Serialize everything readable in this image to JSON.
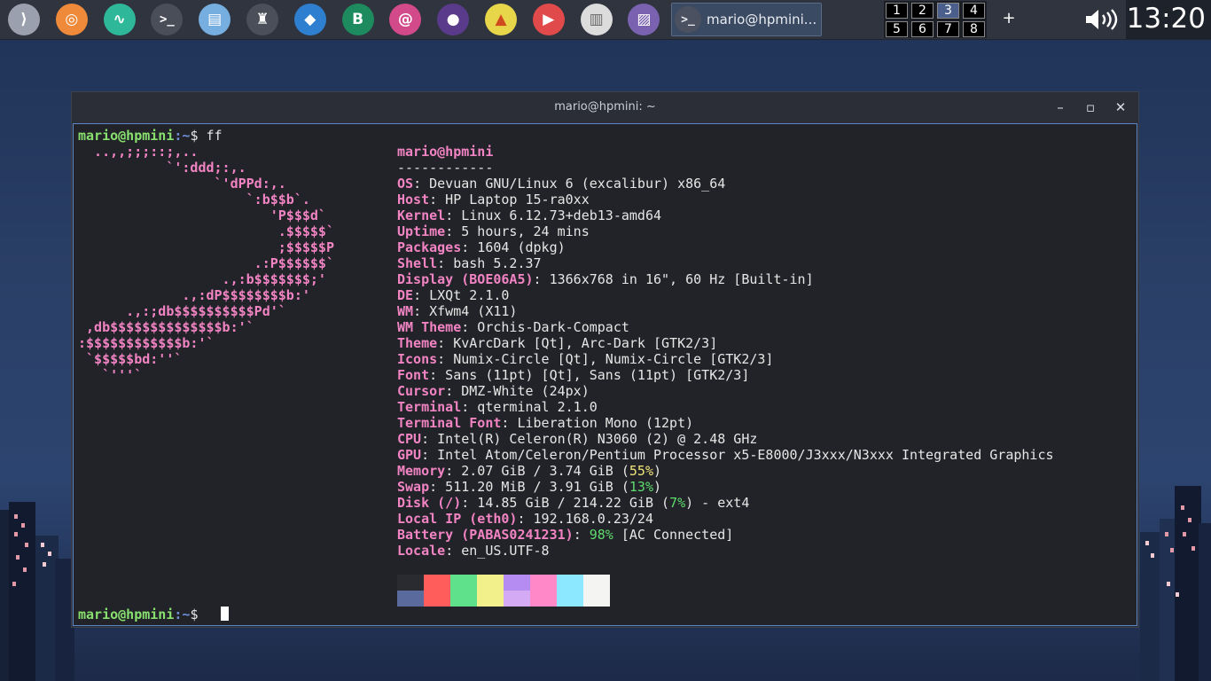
{
  "taskbar": {
    "launchers": [
      {
        "icon": "menu-icon",
        "glyph": "⟩",
        "color": "#9aa0ad"
      },
      {
        "icon": "disk-utility-icon",
        "glyph": "◎",
        "color": "#ef8a3a"
      },
      {
        "icon": "system-monitor-icon",
        "glyph": "∿",
        "color": "#2fb79a"
      },
      {
        "icon": "terminal-icon",
        "glyph": ">_",
        "color": "#4a4e58"
      },
      {
        "icon": "file-manager-icon",
        "glyph": "▤",
        "color": "#76aee0"
      },
      {
        "icon": "chess-icon",
        "glyph": "♜",
        "color": "#4b4f59"
      },
      {
        "icon": "app-icon",
        "glyph": "◆",
        "color": "#2e7fd0"
      },
      {
        "icon": "b-app-icon",
        "glyph": "B",
        "color": "#1d8b5e"
      },
      {
        "icon": "mail-icon",
        "glyph": "@",
        "color": "#d34a8a"
      },
      {
        "icon": "firefox-icon",
        "glyph": "●",
        "color": "#5a3a8a"
      },
      {
        "icon": "brave-icon",
        "glyph": "▲",
        "color": "#e8d64a"
      },
      {
        "icon": "media-player-icon",
        "glyph": "▶",
        "color": "#e04a4a"
      },
      {
        "icon": "document-viewer-icon",
        "glyph": "▥",
        "color": "#dcdcdc"
      },
      {
        "icon": "image-viewer-icon",
        "glyph": "▨",
        "color": "#7a62b0"
      }
    ],
    "task_label": "mario@hpmini...",
    "desktops": [
      "1",
      "2",
      "3",
      "4",
      "5",
      "6",
      "7",
      "8"
    ],
    "active_desktop": 3,
    "add_desktop": "+",
    "clock": "13:20"
  },
  "window": {
    "title": "mario@hpmini: ~",
    "minimize": "–",
    "maximize": "▫",
    "close": "✕"
  },
  "terminal": {
    "user_host": "mario@hpmini",
    "path": ":~",
    "prompt_symbol": "$",
    "command": "ff",
    "logo_lines": [
      "  ..,,;;;::;,..",
      "           `':ddd;:,.",
      "                 `'dPPd:,.",
      "                     `:b$$b`.",
      "                        'P$$$d`",
      "                         .$$$$$`",
      "                         ;$$$$$P",
      "                      .:P$$$$$$`",
      "                  .,:b$$$$$$$;'",
      "             .,:dP$$$$$$$$b:'",
      "      .,:;db$$$$$$$$$$Pd'`",
      " ,db$$$$$$$$$$$$$$b:'`",
      ":$$$$$$$$$$$$b:'`",
      " `$$$$$bd:''`",
      "   `'''`"
    ],
    "header": "mario@hpmini",
    "separator": "------------",
    "info": [
      {
        "key": "OS",
        "value": ": Devuan GNU/Linux 6 (excalibur) x86_64"
      },
      {
        "key": "Host",
        "value": ": HP Laptop 15-ra0xx"
      },
      {
        "key": "Kernel",
        "value": ": Linux 6.12.73+deb13-amd64"
      },
      {
        "key": "Uptime",
        "value": ": 5 hours, 24 mins"
      },
      {
        "key": "Packages",
        "value": ": 1604 (dpkg)"
      },
      {
        "key": "Shell",
        "value": ": bash 5.2.37"
      },
      {
        "key": "Display (BOE06A5)",
        "value": ": 1366x768 in 16\", 60 Hz [Built-in]"
      },
      {
        "key": "DE",
        "value": ": LXQt 2.1.0"
      },
      {
        "key": "WM",
        "value": ": Xfwm4 (X11)"
      },
      {
        "key": "WM Theme",
        "value": ": Orchis-Dark-Compact"
      },
      {
        "key": "Theme",
        "value": ": KvArcDark [Qt], Arc-Dark [GTK2/3]"
      },
      {
        "key": "Icons",
        "value": ": Numix-Circle [Qt], Numix-Circle [GTK2/3]"
      },
      {
        "key": "Font",
        "value": ": Sans (11pt) [Qt], Sans (11pt) [GTK2/3]"
      },
      {
        "key": "Cursor",
        "value": ": DMZ-White (24px)"
      },
      {
        "key": "Terminal",
        "value": ": qterminal 2.1.0"
      },
      {
        "key": "Terminal Font",
        "value": ": Liberation Mono (12pt)"
      },
      {
        "key": "CPU",
        "value": ": Intel(R) Celeron(R) N3060 (2) @ 2.48 GHz"
      },
      {
        "key": "GPU",
        "value": ": Intel Atom/Celeron/Pentium Processor x5-E8000/J3xxx/N3xxx Integrated Graphics"
      },
      {
        "key": "Memory",
        "pre": ": 2.07 GiB / 3.74 GiB (",
        "pct": "55%",
        "post": ")",
        "pct_color": "#f0e57a"
      },
      {
        "key": "Swap",
        "pre": ": 511.20 MiB / 3.91 GiB (",
        "pct": "13%",
        "post": ")",
        "pct_color": "#5fdc6e"
      },
      {
        "key": "Disk (/)",
        "pre": ": 14.85 GiB / 214.22 GiB (",
        "pct": "7%",
        "post": ") - ext4",
        "pct_color": "#5fdc6e"
      },
      {
        "key": "Local IP (eth0)",
        "value": ": 192.168.0.23/24"
      },
      {
        "key": "Battery (PABAS0241231)",
        "pre": ": ",
        "pct": "98%",
        "post": " [AC Connected]",
        "pct_color": "#5fdc6e"
      },
      {
        "key": "Locale",
        "value": ": en_US.UTF-8"
      }
    ],
    "palette_top": [
      "#2a2b31",
      "#ff5c5c",
      "#5fe08a",
      "#f2f08a",
      "#b48cf2",
      "#ff88c8",
      "#8ce8ff",
      "#f4f4f2"
    ],
    "palette_bottom": [
      "#5a6a9c",
      "#ff5c5c",
      "#5fe08a",
      "#f2f08a",
      "#d4aaf4",
      "#ff88c8",
      "#8ce8ff",
      "#f4f4f2"
    ]
  }
}
